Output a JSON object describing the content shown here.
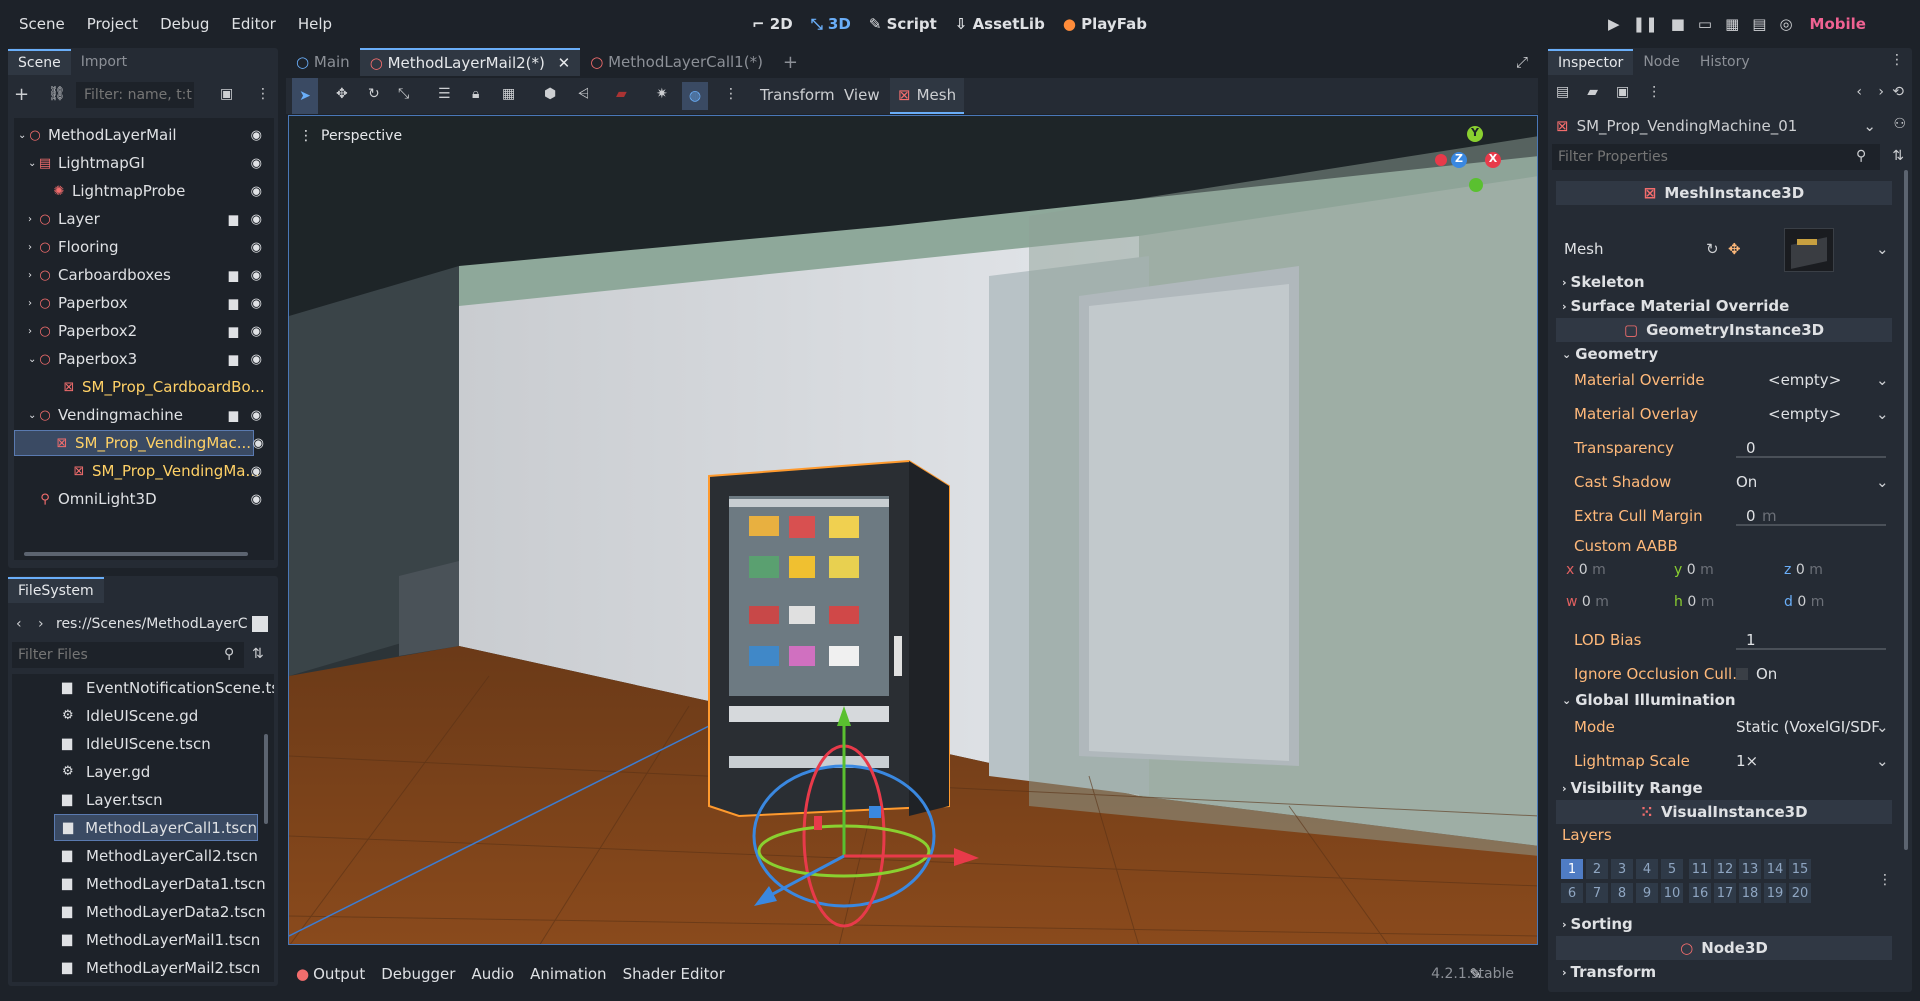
{
  "menu": [
    "Scene",
    "Project",
    "Debug",
    "Editor",
    "Help"
  ],
  "workspaces": {
    "w2d": "2D",
    "w3d": "3D",
    "script": "Script",
    "assetlib": "AssetLib",
    "playfab": "PlayFab"
  },
  "renderer": "Mobile",
  "scene_dock": {
    "tab_scene": "Scene",
    "tab_import": "Import",
    "filter_placeholder": "Filter: name, t:t",
    "nodes": [
      {
        "label": "MethodLayerMail",
        "icon": "node3d-icon"
      },
      {
        "label": "LightmapGI",
        "icon": "lightmap-icon"
      },
      {
        "label": "LightmapProbe",
        "icon": "probe-icon"
      },
      {
        "label": "Layer",
        "icon": "node3d-icon"
      },
      {
        "label": "Flooring",
        "icon": "node3d-icon"
      },
      {
        "label": "Carboardboxes",
        "icon": "node3d-icon"
      },
      {
        "label": "Paperbox",
        "icon": "node3d-icon"
      },
      {
        "label": "Paperbox2",
        "icon": "node3d-icon"
      },
      {
        "label": "Paperbox3",
        "icon": "node3d-icon"
      },
      {
        "label": "SM_Prop_CardboardBo...",
        "icon": "mesh-icon"
      },
      {
        "label": "Vendingmachine",
        "icon": "node3d-icon"
      },
      {
        "label": "SM_Prop_VendingMac...",
        "icon": "mesh-icon"
      },
      {
        "label": "SM_Prop_VendingMa...",
        "icon": "mesh-icon"
      },
      {
        "label": "OmniLight3D",
        "icon": "light-icon"
      }
    ]
  },
  "filesystem": {
    "title": "FileSystem",
    "path": "res://Scenes/MethodLayerC",
    "filter_placeholder": "Filter Files",
    "files": [
      "EventNotificationScene.ts...",
      "IdleUIScene.gd",
      "IdleUIScene.tscn",
      "Layer.gd",
      "Layer.tscn",
      "MethodLayerCall1.tscn",
      "MethodLayerCall2.tscn",
      "MethodLayerData1.tscn",
      "MethodLayerData2.tscn",
      "MethodLayerMail1.tscn",
      "MethodLayerMail2.tscn"
    ]
  },
  "editor_tabs": [
    "Main",
    "MethodLayerMail2(*)",
    "MethodLayerCall1(*)"
  ],
  "viewport_toolbar": {
    "transform": "Transform",
    "view": "View",
    "mesh": "Mesh"
  },
  "viewport": {
    "perspective": "Perspective",
    "gizmo_y": "Y",
    "gizmo_z": "Z",
    "gizmo_x": "X"
  },
  "bottom_tabs": [
    "Output",
    "Debugger",
    "Audio",
    "Animation",
    "Shader Editor"
  ],
  "version": "4.2.1.stable",
  "inspector": {
    "tab_inspector": "Inspector",
    "tab_node": "Node",
    "tab_history": "History",
    "object": "SM_Prop_VendingMachine_01",
    "filter_placeholder": "Filter Properties",
    "cls_mesh": "MeshInstance3D",
    "mesh_label": "Mesh",
    "skeleton": "Skeleton",
    "surface_override": "Surface Material Override",
    "cls_geom": "GeometryInstance3D",
    "geometry": "Geometry",
    "material_override": "Material Override",
    "material_override_val": "<empty>",
    "material_overlay": "Material Overlay",
    "material_overlay_val": "<empty>",
    "transparency": "Transparency",
    "transparency_val": "0",
    "cast_shadow": "Cast Shadow",
    "cast_shadow_val": "On",
    "extra_cull": "Extra Cull Margin",
    "extra_cull_val": "0",
    "extra_cull_unit": "m",
    "custom_aabb": "Custom AABB",
    "aabb": [
      {
        "k": "x",
        "v": "0",
        "u": "m"
      },
      {
        "k": "y",
        "v": "0",
        "u": "m"
      },
      {
        "k": "z",
        "v": "0",
        "u": "m"
      },
      {
        "k": "w",
        "v": "0",
        "u": "m"
      },
      {
        "k": "h",
        "v": "0",
        "u": "m"
      },
      {
        "k": "d",
        "v": "0",
        "u": "m"
      }
    ],
    "lod_bias": "LOD Bias",
    "lod_bias_val": "1",
    "ignore_occ": "Ignore Occlusion Cull...",
    "ignore_occ_val": "On",
    "gi": "Global Illumination",
    "mode": "Mode",
    "mode_val": "Static (VoxelGI/SDF",
    "lightmap_scale": "Lightmap Scale",
    "lightmap_scale_val": "1×",
    "visibility_range": "Visibility Range",
    "cls_visual": "VisualInstance3D",
    "layers": "Layers",
    "layer_nums": [
      "1",
      "2",
      "3",
      "4",
      "5",
      "11",
      "12",
      "13",
      "14",
      "15",
      "6",
      "7",
      "8",
      "9",
      "10",
      "16",
      "17",
      "18",
      "19",
      "20"
    ],
    "sorting": "Sorting",
    "cls_node3d": "Node3D",
    "transform": "Transform"
  },
  "colors": {
    "accent": "#6aaef8",
    "selection": "#ff9a2e"
  }
}
